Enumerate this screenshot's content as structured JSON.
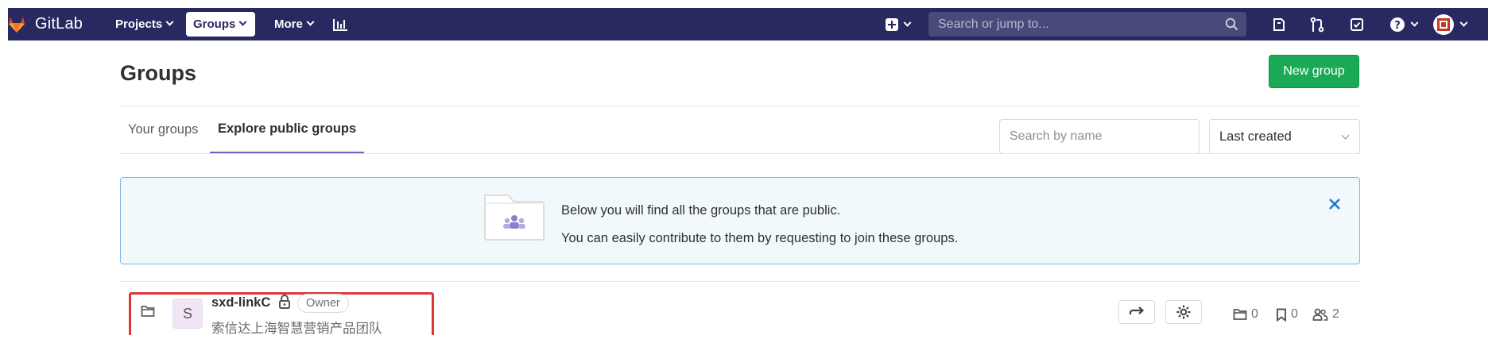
{
  "navbar": {
    "brand": "GitLab",
    "items": [
      {
        "label": "Projects"
      },
      {
        "label": "Groups"
      },
      {
        "label": "More"
      }
    ],
    "search_placeholder": "Search or jump to...",
    "colors": {
      "background": "#292961",
      "accent": "#6666c4"
    },
    "icons": [
      "analytics-icon",
      "plus-square-icon",
      "search-icon",
      "issues-icon",
      "merge-request-icon",
      "todo-icon",
      "help-icon",
      "user-avatar-icon"
    ]
  },
  "page": {
    "title": "Groups",
    "new_group_label": "New group",
    "tabs": [
      {
        "label": "Your groups",
        "active": false
      },
      {
        "label": "Explore public groups",
        "active": true
      }
    ],
    "search_placeholder": "Search by name",
    "sort_selected": "Last created"
  },
  "alert": {
    "line1": "Below you will find all the groups that are public.",
    "line2": "You can easily contribute to them by requesting to join these groups."
  },
  "groups": [
    {
      "avatar_letter": "S",
      "name": "sxd-linkC",
      "role": "Owner",
      "description": "索信达上海智慧营销产品团队",
      "subgroups": "0",
      "projects": "0",
      "members": "2"
    }
  ]
}
